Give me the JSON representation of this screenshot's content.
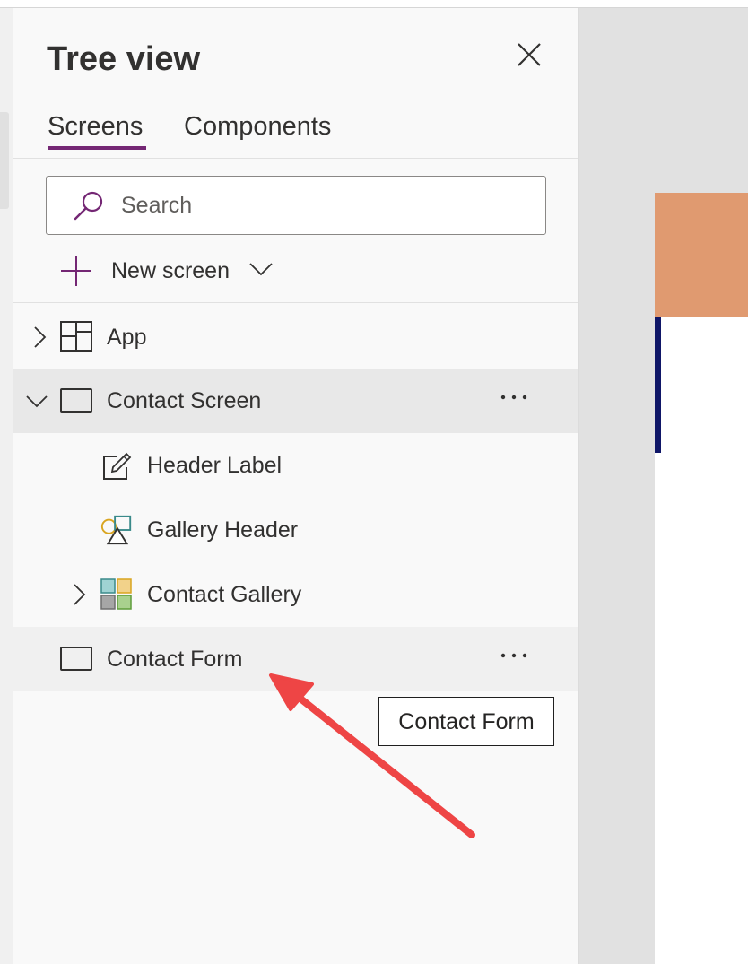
{
  "panel": {
    "title": "Tree view",
    "close_icon": "close-icon"
  },
  "tabs": [
    {
      "label": "Screens",
      "active": true
    },
    {
      "label": "Components",
      "active": false
    }
  ],
  "search": {
    "placeholder": "Search",
    "icon": "search-icon"
  },
  "new_screen": {
    "label": "New screen",
    "icon": "plus-icon",
    "chevron_icon": "chevron-down-icon"
  },
  "tree": [
    {
      "label": "App",
      "icon": "app-icon",
      "expander": "chevron-right-icon",
      "level": 0
    },
    {
      "label": "Contact Screen",
      "icon": "screen-icon",
      "expander": "chevron-down-icon",
      "level": 0,
      "selected": true,
      "more": "···"
    },
    {
      "label": "Header Label",
      "icon": "label-edit-icon",
      "level": 1
    },
    {
      "label": "Gallery Header",
      "icon": "shapes-icon",
      "level": 1
    },
    {
      "label": "Contact Gallery",
      "icon": "gallery-icon",
      "expander": "chevron-right-icon",
      "level": 1
    },
    {
      "label": "Contact Form",
      "icon": "screen-icon",
      "level": 0,
      "hovered": true,
      "more": "···"
    }
  ],
  "tooltip": {
    "text": "Contact Form"
  },
  "colors": {
    "accent": "#742774",
    "canvas_header": "#e09a70",
    "canvas_accent": "#0f1667",
    "annotation_arrow": "#ee4545"
  }
}
